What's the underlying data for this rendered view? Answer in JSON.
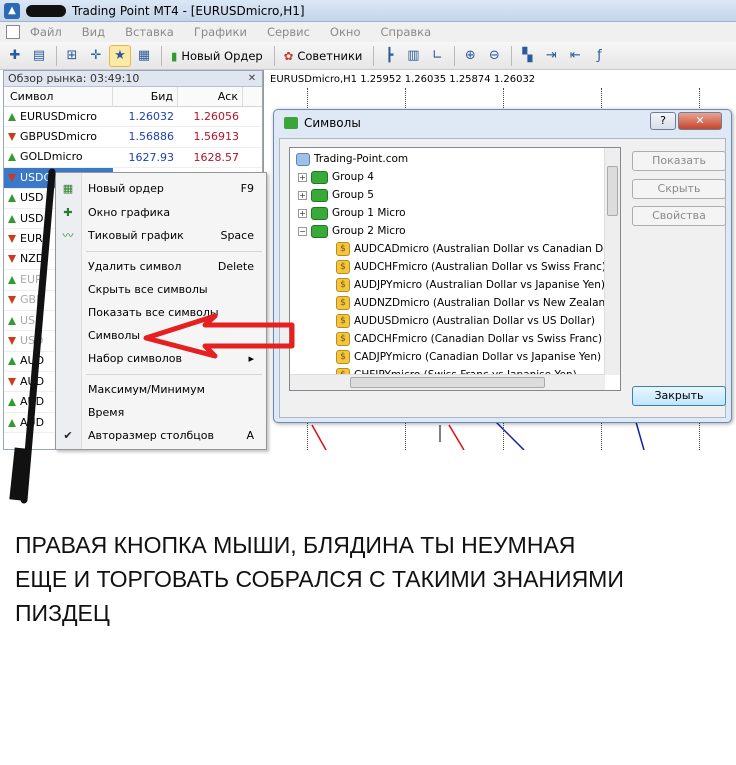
{
  "window": {
    "title": "Trading Point MT4 - [EURUSDmicro,H1]"
  },
  "menu": [
    "Файл",
    "Вид",
    "Вставка",
    "Графики",
    "Сервис",
    "Окно",
    "Справка"
  ],
  "toolbar": {
    "new_order": "Новый Ордер",
    "advisors": "Советники"
  },
  "market_watch": {
    "title": "Обзор рынка: 03:49:10",
    "col_symbol": "Символ",
    "col_bid": "Бид",
    "col_ask": "Аск",
    "rows": [
      {
        "symbol": "EURUSDmicro",
        "bid": "1.26032",
        "ask": "1.26056",
        "dir": "up"
      },
      {
        "symbol": "GBPUSDmicro",
        "bid": "1.56886",
        "ask": "1.56913",
        "dir": "down"
      },
      {
        "symbol": "GOLDmicro",
        "bid": "1627.93",
        "ask": "1628.57",
        "dir": "up"
      },
      {
        "symbol": "USDC",
        "dir": "down"
      },
      {
        "symbol": "USD",
        "dir": "up"
      },
      {
        "symbol": "USD",
        "dir": "up"
      },
      {
        "symbol": "EUR",
        "dir": "down"
      },
      {
        "symbol": "NZD",
        "dir": "down"
      },
      {
        "symbol": "EUR",
        "dir": "up"
      },
      {
        "symbol": "GBP",
        "dir": "down"
      },
      {
        "symbol": "USD",
        "dir": "up"
      },
      {
        "symbol": "USD",
        "dir": "down"
      },
      {
        "symbol": "AUD",
        "dir": "up"
      },
      {
        "symbol": "AUD",
        "dir": "down"
      },
      {
        "symbol": "AUD",
        "dir": "up"
      },
      {
        "symbol": "AUD",
        "dir": "up"
      }
    ]
  },
  "chart": {
    "header": "EURUSDmicro,H1  1.25952 1.26035 1.25874 1.26032"
  },
  "context_menu": {
    "items": [
      {
        "label": "Новый ордер",
        "key": "F9"
      },
      {
        "label": "Окно графика",
        "key": ""
      },
      {
        "label": "Тиковый график",
        "key": "Space"
      },
      {
        "label": "Удалить символ",
        "key": "Delete"
      },
      {
        "label": "Скрыть все символы",
        "key": ""
      },
      {
        "label": "Показать все символы",
        "key": ""
      },
      {
        "label": "Символы",
        "key": ""
      },
      {
        "label": "Набор символов",
        "key": "▸"
      },
      {
        "label": "Максимум/Минимум",
        "key": ""
      },
      {
        "label": "Время",
        "key": ""
      },
      {
        "label": "Авторазмер столбцов",
        "key": "A"
      }
    ]
  },
  "symbols_dialog": {
    "title": "Символы",
    "help": "?",
    "close_x": "✕",
    "root": "Trading-Point.com",
    "groups": [
      "Group 4",
      "Group 5",
      "Group 1 Micro",
      "Group 2 Micro"
    ],
    "items": [
      "AUDCADmicro  (Australian Dollar vs Canadian Dolla",
      "AUDCHFmicro  (Australian Dollar vs Swiss Franc)",
      "AUDJPYmicro  (Australian Dollar vs Japanise Yen)",
      "AUDNZDmicro  (Australian Dollar vs New Zealand D",
      "AUDUSDmicro  (Australian Dollar vs US Dollar)",
      "CADCHFmicro  (Canadian Dollar vs Swiss Franc)",
      "CADJPYmicro  (Canadian Dollar vs Japanise Yen)",
      "CHFJPYmicro  (Swiss Franc vs Japanise Yen)"
    ],
    "buttons": {
      "show": "Показать",
      "hide": "Скрыть",
      "properties": "Свойства",
      "close": "Закрыть"
    }
  },
  "caption": [
    "ПРАВАЯ КНОПКА МЫШИ, БЛЯДИНА ТЫ НЕУМНАЯ",
    "ЕЩЕ И ТОРГОВАТЬ СОБРАЛСЯ С ТАКИМИ ЗНАНИЯМИ",
    "ПИЗДЕЦ"
  ],
  "colors": {
    "bid": "#1a3fb3",
    "ask": "#b3122a",
    "up_arrow": "#2e9d2e",
    "down_arrow": "#d03a1a",
    "annotation_arrow": "#e52020"
  }
}
